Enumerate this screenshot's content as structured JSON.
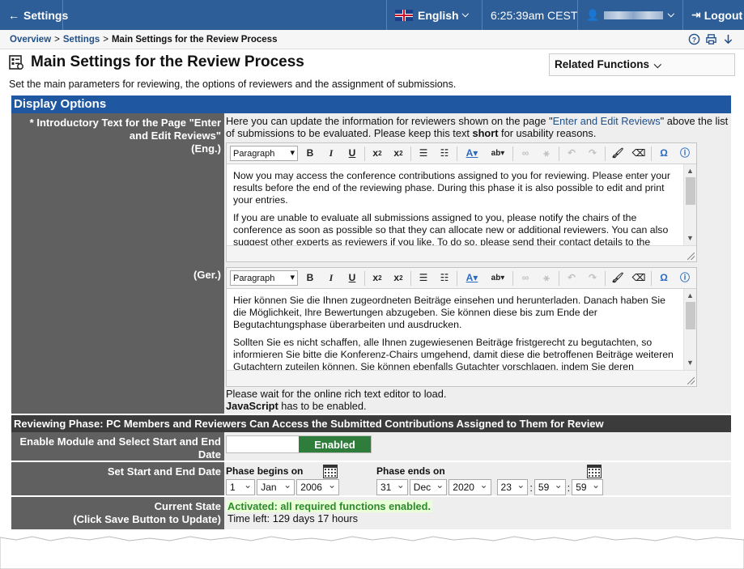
{
  "topbar": {
    "back_label": "Settings",
    "language": "English",
    "time": "6:25:39am CEST",
    "logout_label": "Logout"
  },
  "breadcrumb": {
    "overview": "Overview",
    "settings": "Settings",
    "current": "Main Settings for the Review Process"
  },
  "page": {
    "title": "Main Settings for the Review Process",
    "related_functions": "Related Functions",
    "subtitle": "Set the main parameters for reviewing, the options of reviewers and the assignment of submissions."
  },
  "display_options": {
    "header": "Display Options",
    "intro_label": "* Introductory Text for the Page \"Enter and Edit Reviews\"",
    "eng_label": "(Eng.)",
    "ger_label": "(Ger.)",
    "intro_text_1": "Here you can update the information for reviewers shown on the page \"",
    "intro_link": "Enter and Edit Reviews",
    "intro_text_2": "\" above the list of submissions to be evaluated. Please keep this text ",
    "intro_bold": "short",
    "intro_text_3": " for usability reasons.",
    "editor_format": "Paragraph",
    "eng_p1": "Now you may access the conference contributions assigned to you for reviewing. Please enter your results before the end of the reviewing phase. During this phase it is also possible to edit and print your entries.",
    "eng_p2": "If you are unable to evaluate all submissions assigned to you, please notify the chairs of the conference as soon as possible so that they can allocate new or additional reviewers. You can also suggest other experts as reviewers if you like. To do so, please send their contact details to the",
    "ger_p1": "Hier können Sie die Ihnen zugeordneten Beiträge einsehen und herunterladen. Danach haben Sie die Möglichkeit, Ihre Bewertungen abzugeben. Sie können diese bis zum Ende der Begutachtungsphase überarbeiten und ausdrucken.",
    "ger_p2": "Sollten Sie es nicht schaffen, alle Ihnen zugewiesenen Beiträge fristgerecht zu begutachten, so informieren Sie bitte die Konferenz-Chairs umgehend, damit diese die betroffenen Beiträge weiteren Gutachtern zuteilen können. Sie können ebenfalls Gutachter vorschlagen, indem Sie deren",
    "wait_text": "Please wait for the online rich text editor to load.",
    "js_bold": "JavaScript",
    "js_text": " has to be enabled."
  },
  "reviewing_phase": {
    "header": "Reviewing Phase: PC Members and Reviewers Can Access the Submitted Contributions Assigned to Them for Review",
    "enable_label": "Enable Module and Select Start and End Date",
    "enabled": "Enabled",
    "dates_label": "Set Start and End Date",
    "begins_label": "Phase begins on",
    "ends_label": "Phase ends on",
    "begin_day": "1",
    "begin_month": "Jan",
    "begin_year": "2006",
    "end_day": "31",
    "end_month": "Dec",
    "end_year": "2020",
    "end_hour": "23",
    "end_minute": "59",
    "end_second": "59",
    "time_sep": ":",
    "state_label_1": "Current State",
    "state_label_2": "(Click Save Button to Update)",
    "state_active": "Activated: all required functions enabled.",
    "time_left": "Time left: 129 days 17 hours"
  },
  "colors": {
    "topbar": "#2d5e97",
    "section": "#1f57a0",
    "label_bg": "#606060",
    "enabled_green": "#2e7d3b",
    "active_text": "#2c8a2c"
  }
}
